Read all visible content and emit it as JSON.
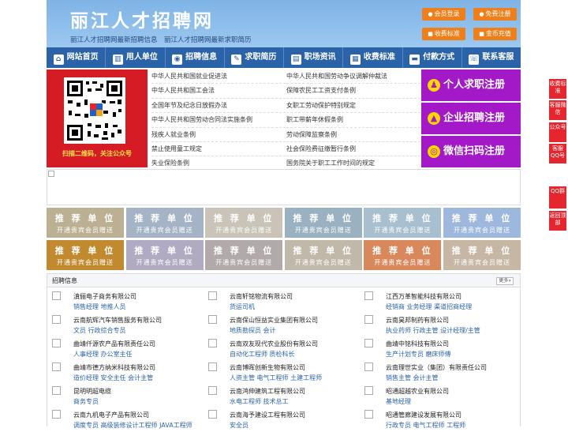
{
  "header": {
    "title": "丽江人才招聘网",
    "subtitle": "丽江人才招聘网最新招聘信息　丽江人才招聘网最新求职简历",
    "buttons": [
      {
        "label": "会员登录",
        "icon": "user-icon"
      },
      {
        "label": "免费注册",
        "icon": "user-plus-icon"
      },
      {
        "label": "收费标准",
        "icon": "tag-icon"
      },
      {
        "label": "金币充值",
        "icon": "coin-icon"
      }
    ]
  },
  "nav": [
    {
      "label": "网站首页",
      "icon": "home-icon"
    },
    {
      "label": "用人单位",
      "icon": "building-icon"
    },
    {
      "label": "招聘信息",
      "icon": "briefcase-icon"
    },
    {
      "label": "求职简历",
      "icon": "resume-icon"
    },
    {
      "label": "职场资讯",
      "icon": "news-icon"
    },
    {
      "label": "收费标准",
      "icon": "price-icon"
    },
    {
      "label": "付款方式",
      "icon": "card-icon"
    },
    {
      "label": "联系客服",
      "icon": "phone-icon"
    }
  ],
  "qr": {
    "caption": "扫描二维码，关注公众号"
  },
  "laws": {
    "left": [
      "中华人民共和国就业促进法",
      "中华人民共和国工会法",
      "全国年节及纪念日放假办法",
      "中华人民共和国劳动合同法实施条例",
      "残疾人就业条例",
      "禁止使用童工规定",
      "失业保险条例"
    ],
    "right": [
      "中华人民共和国劳动争议调解仲裁法",
      "保障农民工工资支付条例",
      "女职工劳动保护特别规定",
      "职工带薪年休假条例",
      "劳动保障监察条例",
      "社会保险费征缴暂行条例",
      "国务院关于职工工作时间的规定"
    ]
  },
  "register": [
    {
      "label": "个人求职注册",
      "icon": "person-icon"
    },
    {
      "label": "企业招聘注册",
      "icon": "company-icon"
    },
    {
      "label": "微信扫码注册",
      "icon": "wechat-icon"
    }
  ],
  "recommend": {
    "title": "推 荐 单 位",
    "sub": "开通贵宾会员赠送",
    "colors": [
      "#bcb092",
      "#a4b3c6",
      "#c9c3b8",
      "#9ab1c2",
      "#a7bfcf",
      "#9db7dd",
      "#c28a2f",
      "#b0aac2",
      "#b2aaaa",
      "#c0b8a8",
      "#d9885c",
      "#c6b7a5"
    ]
  },
  "jobs": {
    "heading": "招聘信息",
    "more": "更多»",
    "companies": [
      {
        "name": "滇俪电子商务有限公司",
        "positions": "销售经理 地推人员"
      },
      {
        "name": "云南轩铭物流有限公司",
        "positions": "货运司机"
      },
      {
        "name": "江西万革智能科技有限公司",
        "positions": "经销商 业务经理 渠道招商经理"
      },
      {
        "name": "云南航辉汽车销售服务有限公司",
        "positions": "文员 行政综合专员"
      },
      {
        "name": "云南保山恒益实业集团有限公司",
        "positions": "地质勘探员 会计"
      },
      {
        "name": "云南昊邦制药有限公司",
        "positions": "执业药师 行政主管 设计经理/主管"
      },
      {
        "name": "曲靖仟源农产品有限责任公司",
        "positions": "人事经理 办公室主任"
      },
      {
        "name": "云南双友现代农业股份有限公司",
        "positions": "自动化工程师 质检科长"
      },
      {
        "name": "曲靖中铭科技有限公司",
        "positions": "生产计划专员 磨床师傅"
      },
      {
        "name": "曲靖市德方纳米科技有限公司",
        "positions": "造价经理 安全主任 会计主管"
      },
      {
        "name": "云南博晖创新生物有限公司",
        "positions": "人资主管 电气工程师 土建工程师"
      },
      {
        "name": "云南理世实业（集团）有限责任公司",
        "positions": "销售主管 会计主管"
      },
      {
        "name": "昆明明超电缆",
        "positions": "商务专员"
      },
      {
        "name": "云南鸿伸建筑工程有限公司",
        "positions": "水电工程师 技术总工"
      },
      {
        "name": "昭通超越农业有限公司",
        "positions": "基地经理"
      },
      {
        "name": "云南九机电子产品有限公司",
        "positions": "调度专员 高级装修设计工程师 JAVA工程师"
      },
      {
        "name": "云南海予建设工程有限公司",
        "positions": "安全员"
      },
      {
        "name": "昭通管廊建设发展有限公司",
        "positions": "行政专员 电气工程师 工程师"
      }
    ]
  },
  "side": [
    {
      "label": "收费标准"
    },
    {
      "label": "客服微信"
    },
    {
      "label": "公众号"
    },
    {
      "label": "客服QQ号"
    },
    {
      "label": "QQ群"
    },
    {
      "label": "返回顶部"
    }
  ]
}
